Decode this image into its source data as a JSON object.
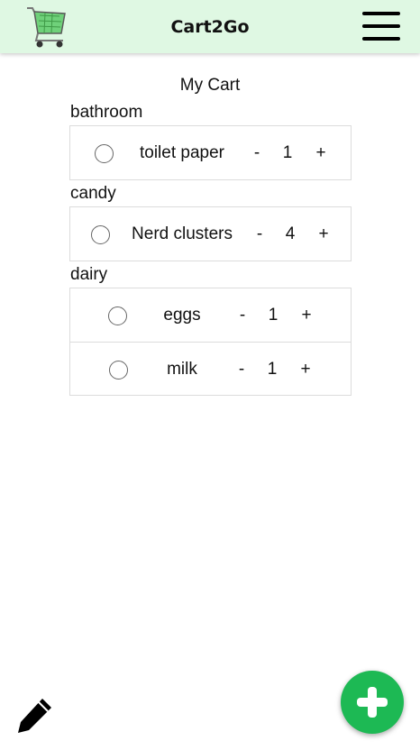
{
  "header": {
    "app_title": "Cart2Go",
    "logo_icon": "shopping-cart-icon",
    "menu_icon": "hamburger-menu-icon"
  },
  "page": {
    "title": "My Cart"
  },
  "categories": [
    {
      "label": "bathroom",
      "items": [
        {
          "name": "toilet paper",
          "qty": "1"
        }
      ]
    },
    {
      "label": "candy",
      "items": [
        {
          "name": "Nerd clusters",
          "qty": "4"
        }
      ]
    },
    {
      "label": "dairy",
      "items": [
        {
          "name": "eggs",
          "qty": "1"
        },
        {
          "name": "milk",
          "qty": "1"
        }
      ]
    }
  ],
  "controls": {
    "minus": "-",
    "plus": "+"
  },
  "footer": {
    "edit_icon": "pencil-icon",
    "add_icon": "plus-icon"
  },
  "colors": {
    "header_bg": "#dff8e3",
    "accent": "#1db954"
  }
}
